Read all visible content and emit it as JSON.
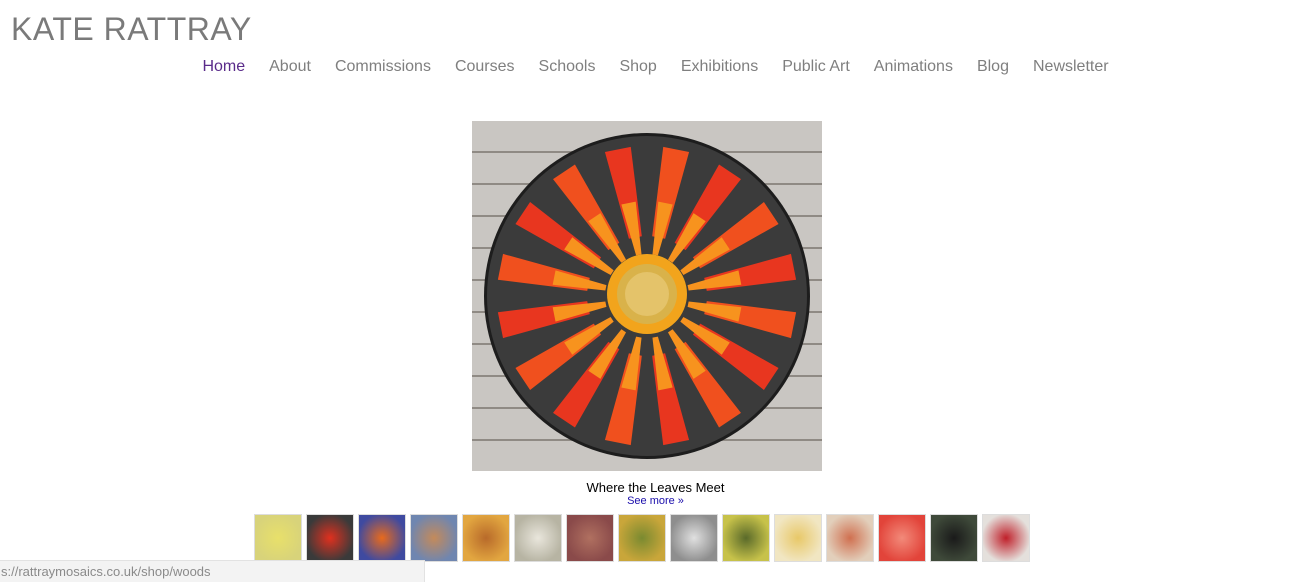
{
  "site": {
    "title": "KATE RATTRAY"
  },
  "nav": {
    "items": [
      {
        "label": "Home",
        "active": true
      },
      {
        "label": "About"
      },
      {
        "label": "Commissions"
      },
      {
        "label": "Courses"
      },
      {
        "label": "Schools"
      },
      {
        "label": "Shop"
      },
      {
        "label": "Exhibitions"
      },
      {
        "label": "Public Art"
      },
      {
        "label": "Animations"
      },
      {
        "label": "Blog"
      },
      {
        "label": "Newsletter"
      }
    ]
  },
  "hero": {
    "caption": "Where the Leaves Meet",
    "see_more": "See more »"
  },
  "thumbnails": [
    {
      "icon": "yellow-flower-mosaic-icon",
      "bg": "#d8d37a",
      "accent": "#e8e06a"
    },
    {
      "icon": "red-leaves-mosaic-icon",
      "bg": "#3a3a3a",
      "accent": "#e0301e"
    },
    {
      "icon": "sunburst-mosaic-icon",
      "bg": "#3f4aa0",
      "accent": "#e86a1c"
    },
    {
      "icon": "blue-grass-mosaic-icon",
      "bg": "#6f86b0",
      "accent": "#c48a5a"
    },
    {
      "icon": "sunflower-mosaic-icon",
      "bg": "#e2a640",
      "accent": "#b86a2a"
    },
    {
      "icon": "tree-stump-icon",
      "bg": "#b7b4a3",
      "accent": "#e9e6dc"
    },
    {
      "icon": "red-swirl-mosaic-icon",
      "bg": "#8a4a4a",
      "accent": "#b07060"
    },
    {
      "icon": "golden-flower-mosaic-icon",
      "bg": "#c9a63a",
      "accent": "#7a8a30"
    },
    {
      "icon": "spiral-shell-mosaic-icon",
      "bg": "#8e8e8e",
      "accent": "#e0e0e0"
    },
    {
      "icon": "yellow-field-mosaic-icon",
      "bg": "#c7c24a",
      "accent": "#5a6a2a"
    },
    {
      "icon": "pale-sunburst-mosaic-icon",
      "bg": "#f1e6c2",
      "accent": "#e8c868"
    },
    {
      "icon": "confetti-mosaic-icon",
      "bg": "#e2cfbb",
      "accent": "#d07050"
    },
    {
      "icon": "red-texture-mosaic-icon",
      "bg": "#e2443a",
      "accent": "#f28a7a"
    },
    {
      "icon": "black-swan-icon",
      "bg": "#3f4a3a",
      "accent": "#1a1a1a"
    },
    {
      "icon": "teeth-mouth-icon",
      "bg": "#e4e0dc",
      "accent": "#c0202a"
    }
  ],
  "status_bar": {
    "url": "s://rattraymosaics.co.uk/shop/woods"
  }
}
